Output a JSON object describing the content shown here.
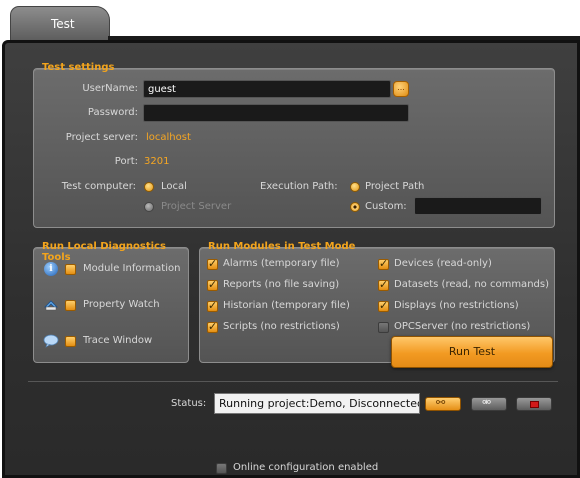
{
  "tab": {
    "label": "Test"
  },
  "test_settings": {
    "title": "Test settings",
    "username_label": "UserName:",
    "username_value": "guest",
    "browse_label": "...",
    "password_label": "Password:",
    "password_value": "",
    "project_server_label": "Project server:",
    "project_server_value": "localhost",
    "port_label": "Port:",
    "port_value": "3201",
    "test_computer_label": "Test computer:",
    "local_label": "Local",
    "project_server_option": "Project Server",
    "execution_path_label": "Execution Path:",
    "project_path_label": "Project Path",
    "custom_label": "Custom:",
    "custom_value": ""
  },
  "diagnostics": {
    "title": "Run Local Diagnostics Tools",
    "items": [
      {
        "label": "Module Information",
        "icon": "info-icon"
      },
      {
        "label": "Property Watch",
        "icon": "property-watch-icon"
      },
      {
        "label": "Trace Window",
        "icon": "trace-window-icon"
      }
    ]
  },
  "modules": {
    "title": "Run Modules in Test Mode",
    "left": [
      {
        "label": "Alarms (temporary file)",
        "checked": true
      },
      {
        "label": "Reports (no file saving)",
        "checked": true
      },
      {
        "label": "Historian (temporary file)",
        "checked": true
      },
      {
        "label": "Scripts (no restrictions)",
        "checked": true
      }
    ],
    "right": [
      {
        "label": "Devices (read-only)",
        "checked": true
      },
      {
        "label": "Datasets (read, no commands)",
        "checked": true
      },
      {
        "label": "Displays (no restrictions)",
        "checked": true
      },
      {
        "label": "OPCServer (no restrictions)",
        "checked": false
      }
    ]
  },
  "run_button": "Run Test",
  "status": {
    "label": "Status:",
    "value": "Running project:Demo, Disconnected",
    "online_config_label": "Online configuration enabled"
  },
  "colors": {
    "accent": "#f5a623",
    "title": "#f3a41c",
    "panel": "#5f5f5f",
    "background": "#333333"
  }
}
